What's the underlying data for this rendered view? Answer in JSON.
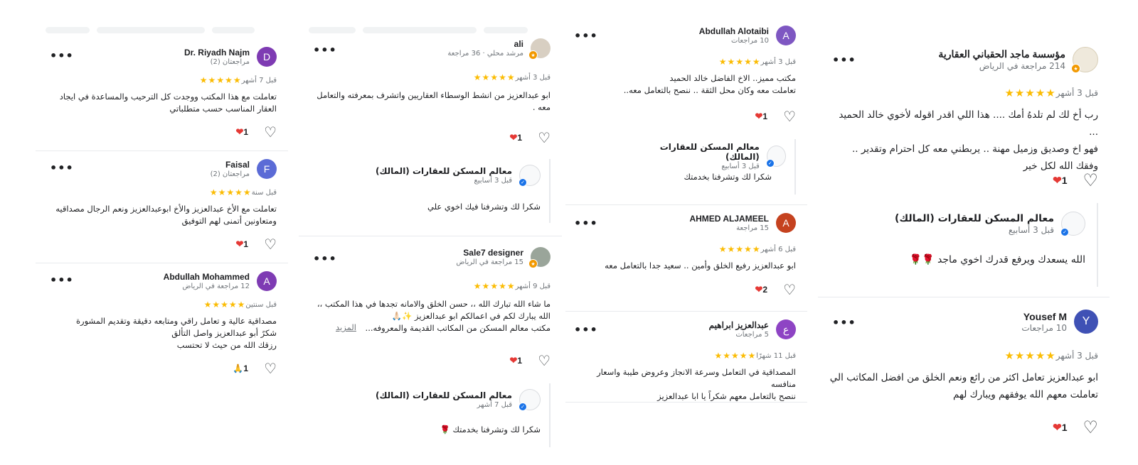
{
  "colors": {
    "star": "#fbbc04",
    "heart": "#e53935",
    "badge_local_guide": "#f29900",
    "verified": "#1a73e8"
  },
  "col1": {
    "r1": {
      "name": "Dr. Riyadh Najm",
      "avatar": "D",
      "color": "#7e3bb3",
      "meta": "مراجعتان (2)",
      "ago": "قبل 7 أشهر",
      "text": "تعاملت مع هذا المكتب ووجدت كل الترحيب والمساعدة في ايجاد\nالعقار المناسب حسب متطلباتي",
      "count": "1"
    },
    "r2": {
      "name": "Faisal",
      "avatar": "F",
      "color": "#5b6bd6",
      "meta": "مراجعتان (2)",
      "ago": "قبل سنة",
      "text": "تعاملت مع الأخ عبدالعزيز والأخ ابوعبدالعزيز ونعم الرجال مصداقيه\nومتعاونين أتمنى لهم التوفيق",
      "count": "1"
    },
    "r3": {
      "name": "Abdullah Mohammed",
      "avatar": "A",
      "color": "#7e3bb3",
      "meta": "12 مراجعة في الرياض",
      "ago": "قبل سنتين",
      "text": "مصداقية عالية و تعامل راقي ومتابعه دقيقة وتقديم المشورة\nشكرً أبو عبدالعزيز  واصل التألق\nرزقك الله من حيث لا تحتسب",
      "count": "1",
      "reaction": "🙏"
    }
  },
  "col2": {
    "r1": {
      "name": "ali",
      "meta": "مرشد محلي · 36 مراجعة",
      "ago": "قبل 3 أشهر",
      "text": "ابو عبدالعزيز من انشط الوسطاء العقاريين واتشرف بمعرفته والتعامل\nمعه .",
      "count": "1",
      "owner_name": "معالم المسكن للعقارات (المالك)",
      "owner_ago": "قبل 3 أسابيع",
      "owner_text": "شكرا لك وتشرفنا فيك اخوي علي"
    },
    "r2": {
      "name": "Sale7 designer",
      "meta": "15 مراجعة في الرياض",
      "ago": "قبل 9 أشهر",
      "text": "ما شاء الله تبارك الله ،، حسن الخلق والامانه تجدها في هذا المكتب ،،\nالله يبارك لكم في اعمالكم ابو عبدالعزيز ✨🙏🏻\nمكتب معالم المسكن من المكاتب القديمة والمعروفه...",
      "more": "المزيد",
      "count": "1",
      "owner_name": "معالم المسكن للعقارات (المالك)",
      "owner_ago": "قبل 7 أشهر",
      "owner_text": "شكرا لك وتشرفنا بخدمتك 🌹"
    }
  },
  "col3": {
    "r1": {
      "name": "Abdullah Alotaibi",
      "avatar": "A",
      "color": "#7e57c2",
      "meta": "10 مراجعات",
      "ago": "قبل 3 أشهر",
      "text": "مكتب مميز.. الاخ الفاضل خالد الحميد\nتعاملت معه وكان محل الثقة .. ننصح بالتعامل معه..",
      "count": "1",
      "owner_name": "معالم المسكن للعقارات (المالك)",
      "owner_ago": "قبل 3 أسابيع",
      "owner_text": "شكرا لك وتشرفنا بخدمتك"
    },
    "r2": {
      "name": "AHMED ALJAMEEL",
      "avatar": "A",
      "color": "#c5421f",
      "meta": "15 مراجعة",
      "ago": "قبل 6 أشهر",
      "text": "ابو عبدالعزيز رفيع الخلق وأمين .. سعيد جدا بالتعامل معه",
      "count": "2"
    },
    "r3": {
      "name": "عبدالعزيز ابراهيم",
      "avatar": "ع",
      "color": "#8e44c4",
      "meta": "5 مراجعات",
      "ago": "قبل 11 شهرًا",
      "text": "المصداقية في التعامل وسرعة الانجاز  وعروض طيبة واسعار منافسه\nننصح بالتعامل معهم  شكراً يا ابا عبدالعزيز"
    }
  },
  "col4": {
    "r1": {
      "name": "مؤسسة ماجد الحقباني العقارية",
      "meta": "214 مراجعة في الرياض",
      "ago": "قبل 3 أشهر",
      "text": "رب أخ  لك لم تلدهُ أمك .... هذا اللي اقدر اقوله لأخوي خالد الحميد ...\nفهو اخ وصديق وزميل مهنة .. يربطني معه كل احترام وتقدير ..\nوفقك الله لكل خير",
      "count": "1",
      "owner_name": "معالم المسكن للعقارات (المالك)",
      "owner_ago": "قبل 3 أسابيع",
      "owner_text": "الله يسعدك ويرفع قدرك اخوي ماجد 🌹🌹"
    },
    "r2": {
      "name": "Yousef M",
      "avatar": "Y",
      "color": "#3f51b5",
      "meta": "10 مراجعات",
      "ago": "قبل 3 أشهر",
      "text": "ابو عبدالعزيز تعامل اكثر من رائع ونعم الخلق من افضل المكاتب الي\nتعاملت معهم الله يوفقهم ويبارك لهم",
      "count": "1"
    }
  },
  "stars": "★★★★★",
  "more_icon": "•••",
  "heart": "♡",
  "heart_full": "❤",
  "verified_icon": "✓"
}
